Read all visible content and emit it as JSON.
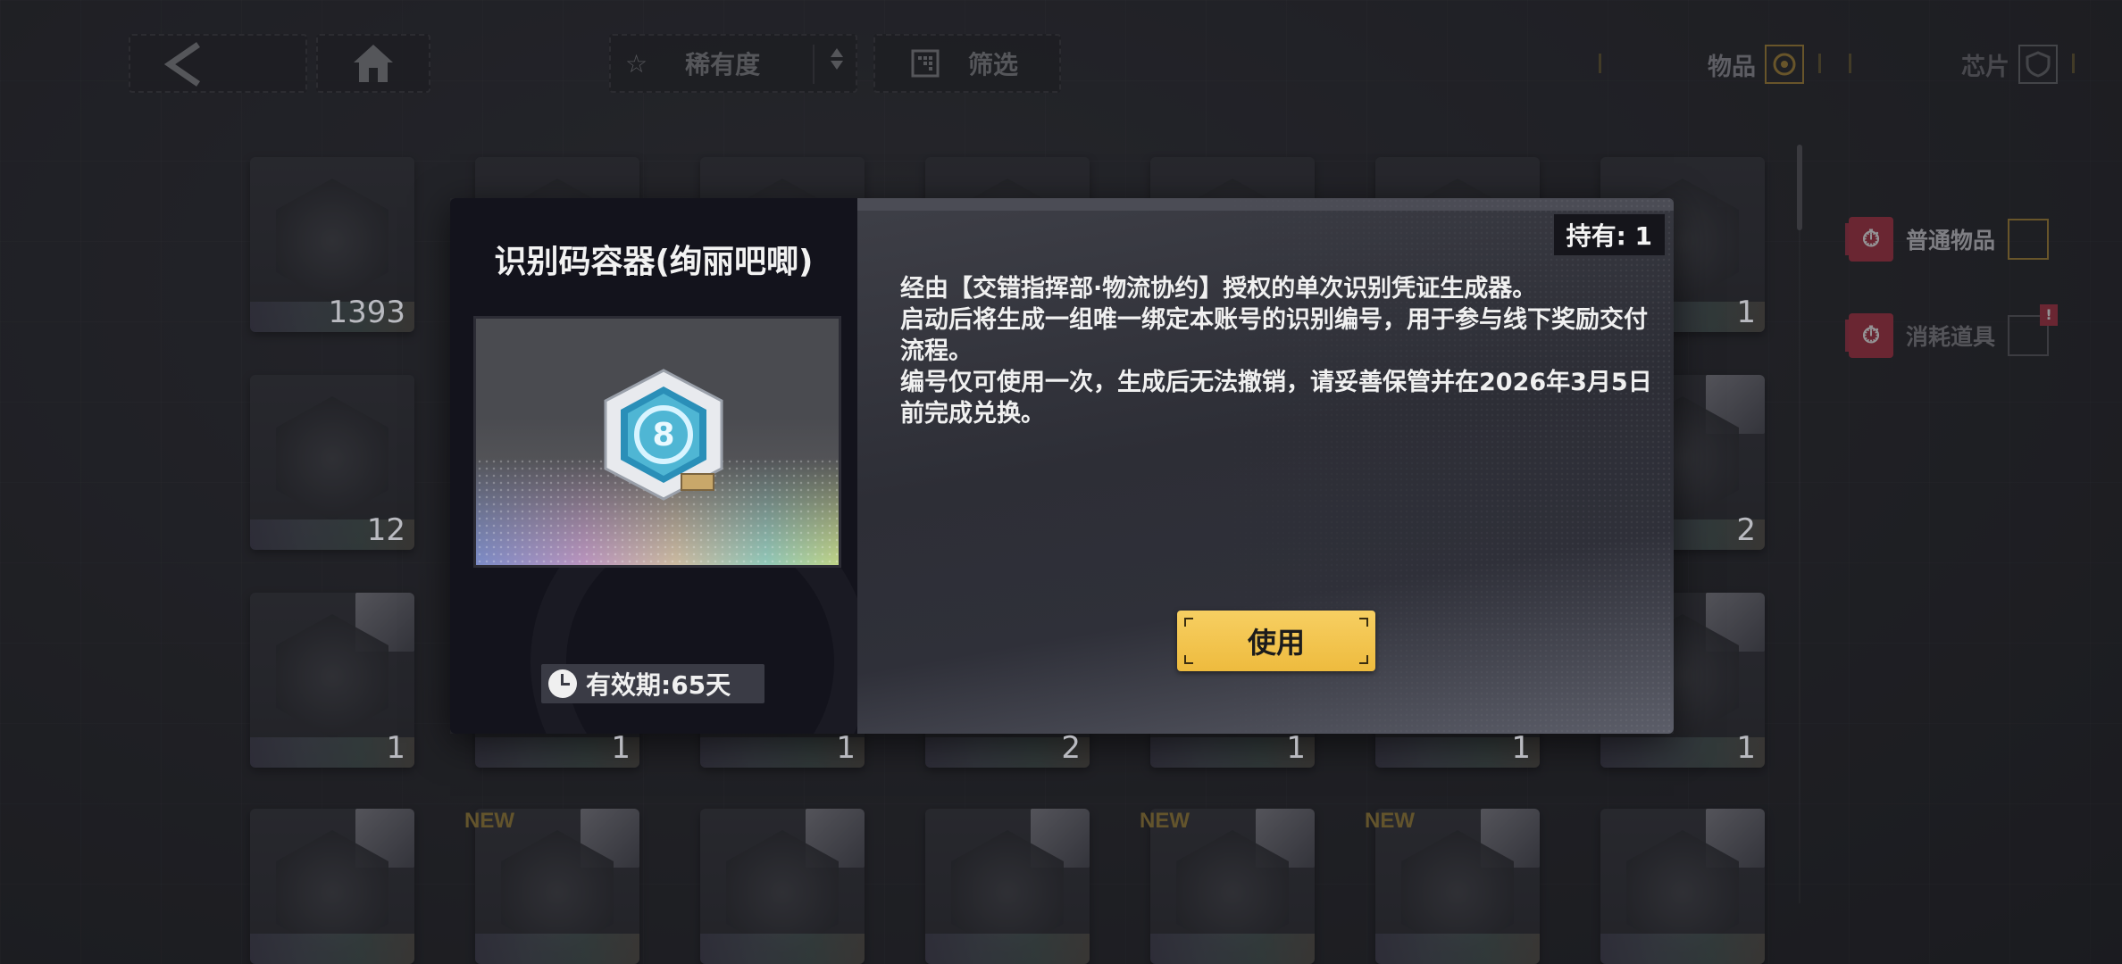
{
  "topbar": {
    "rarity_label": "稀有度",
    "filter_label": "筛选",
    "tab_items": "物品",
    "tab_chips": "芯片"
  },
  "sidebar": {
    "categories": [
      {
        "label": "普通物品",
        "icon": "stopwatch-icon"
      },
      {
        "label": "消耗道具",
        "icon": "cube-icon",
        "badge": "!"
      }
    ]
  },
  "grid": {
    "counts_row1": [
      "1393",
      "1"
    ],
    "counts_row2": [
      "12",
      "2"
    ],
    "counts_row3": [
      "1",
      "1",
      "1",
      "2",
      "1",
      "1",
      "1"
    ],
    "new_tag": "NEW"
  },
  "modal": {
    "title": "识别码容器(绚丽吧唧)",
    "validity": "有效期:65天",
    "hold": "持有: 1",
    "description": [
      "经由【交错指挥部·物流协约】授权的单次识别凭证生成器。",
      "启动后将生成一组唯一绑定本账号的识别编号，用于参与线下奖励交付流程。",
      "编号仅可使用一次，生成后无法撤销，请妥善保管并在2026年3月5日前完成兑换。"
    ],
    "use_label": "使用"
  },
  "colors": {
    "accent_gold": "#eebb3e",
    "accent_red": "#b3374a",
    "modal_left_bg": "#13131c"
  }
}
